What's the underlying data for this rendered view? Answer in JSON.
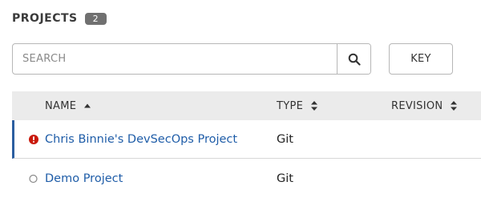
{
  "header": {
    "title": "PROJECTS",
    "count": "2"
  },
  "search": {
    "placeholder": "SEARCH",
    "value": ""
  },
  "toolbar": {
    "key_label": "KEY"
  },
  "table": {
    "columns": [
      {
        "label": "NAME",
        "sort": "ascending"
      },
      {
        "label": "TYPE",
        "sort": "unsorted"
      },
      {
        "label": "REVISION",
        "sort": "unsorted"
      }
    ],
    "rows": [
      {
        "name": "Chris Binnie's DevSecOps Project",
        "type": "Git",
        "status": "error",
        "selected": true
      },
      {
        "name": "Demo Project",
        "type": "Git",
        "status": "never-updated",
        "selected": false
      }
    ]
  },
  "colors": {
    "accent": "#2b5ea0",
    "link": "#1f5da8",
    "error": "#c9190b",
    "badge": "#707070",
    "header_bg": "#ebebeb"
  },
  "icons": {
    "search": "search-icon",
    "sort_asc": "sort-ascending-icon",
    "sort_both": "sort-icon",
    "error": "exclamation-circle-icon",
    "empty_status": "circle-outline-icon"
  }
}
